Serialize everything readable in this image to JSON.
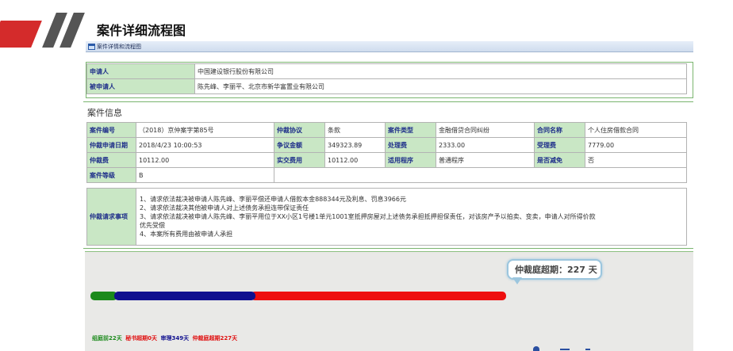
{
  "header": {
    "page_title": "案件详细流程图",
    "tab_label": "案件详情和流程图"
  },
  "parties": {
    "applicant_label": "申请人",
    "applicant_value": "中国建设银行股份有限公司",
    "respondent_label": "被申请人",
    "respondent_value": "陈先峰、李丽平、北京市新华富置业有限公司"
  },
  "case_info": {
    "section_title": "案件信息",
    "row1": {
      "case_no_label": "案件编号",
      "case_no_value": "（2018）京仲案字第85号",
      "agreement_label": "仲裁协议",
      "agreement_value": "条款",
      "case_type_label": "案件类型",
      "case_type_value": "金融借贷合同纠纷",
      "contract_label": "合同名称",
      "contract_value": "个人住房借款合同"
    },
    "row2": {
      "date_label": "仲裁申请日期",
      "date_value": "2018/4/23 10:00:53",
      "amount_label": "争议金额",
      "amount_value": "349323.89",
      "handling_fee_label": "处理费",
      "handling_fee_value": "2333.00",
      "accept_fee_label": "受理费",
      "accept_fee_value": "7779.00"
    },
    "row3": {
      "arb_fee_label": "仲裁费",
      "arb_fee_value": "10112.00",
      "paid_label": "实交费用",
      "paid_value": "10112.00",
      "procedure_label": "适用程序",
      "procedure_value": "普通程序",
      "reduction_label": "是否减免",
      "reduction_value": "否"
    },
    "row4": {
      "level_label": "案件等级",
      "level_value": "B"
    },
    "claims_label": "仲裁请求事项",
    "claims": [
      "1、请求依法裁决被申请人陈先峰、李丽平偿还申请人借款本金888344元及利息、罚息3966元",
      "2、请求依法裁决其他被申请人对上述债务承担连带保证责任",
      "3、请求依法裁决被申请人陈先峰、李丽平用位于XX小区1号楼1单元1001室抵押房屋对上述债务承担抵押担保责任，对该房产予以拍卖、变卖，申请人对所得价款",
      "优先受偿",
      "4、本案所有费用由被申请人承担"
    ]
  },
  "flow": {
    "bubble_text": "仲裁庭超期：227 天",
    "stages": [
      {
        "name": "组庭前",
        "days": 22,
        "color": "#1b8a1b"
      },
      {
        "name": "审理",
        "days": 349,
        "color": "#10108f"
      },
      {
        "name": "仲裁庭超期",
        "days": 227,
        "color": "#ee0f0f"
      }
    ],
    "legend": {
      "pre_formation": "组庭前22天",
      "secretary_overdue": "秘书超期0天",
      "trial": "审理349天",
      "tribunal_overdue": "仲裁庭超期227天"
    }
  }
}
